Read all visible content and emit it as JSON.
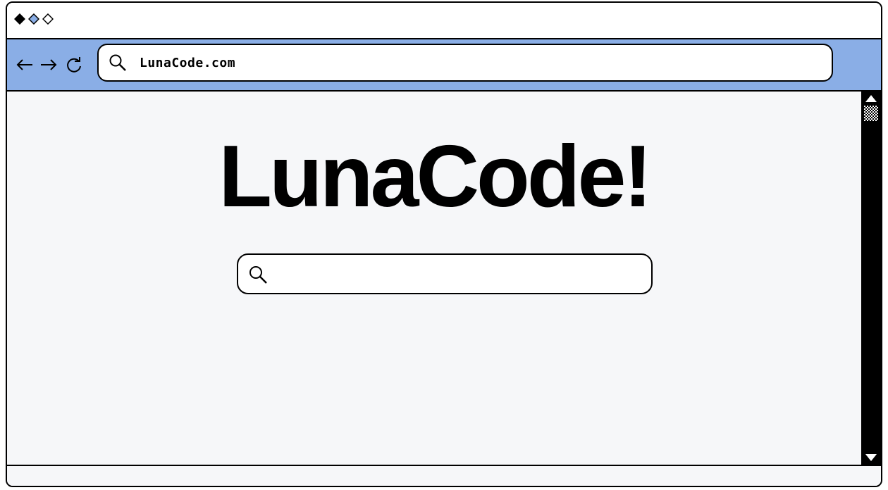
{
  "window": {
    "controls": [
      "close-dot",
      "minimize-dot",
      "maximize-dot"
    ],
    "accent_color": "#8aaee6"
  },
  "toolbar": {
    "nav_icons": [
      "back-arrow-icon",
      "forward-arrow-icon",
      "reload-icon"
    ],
    "address": "LunaCode.com"
  },
  "page": {
    "logo": "LunaCode!",
    "search_placeholder": ""
  }
}
